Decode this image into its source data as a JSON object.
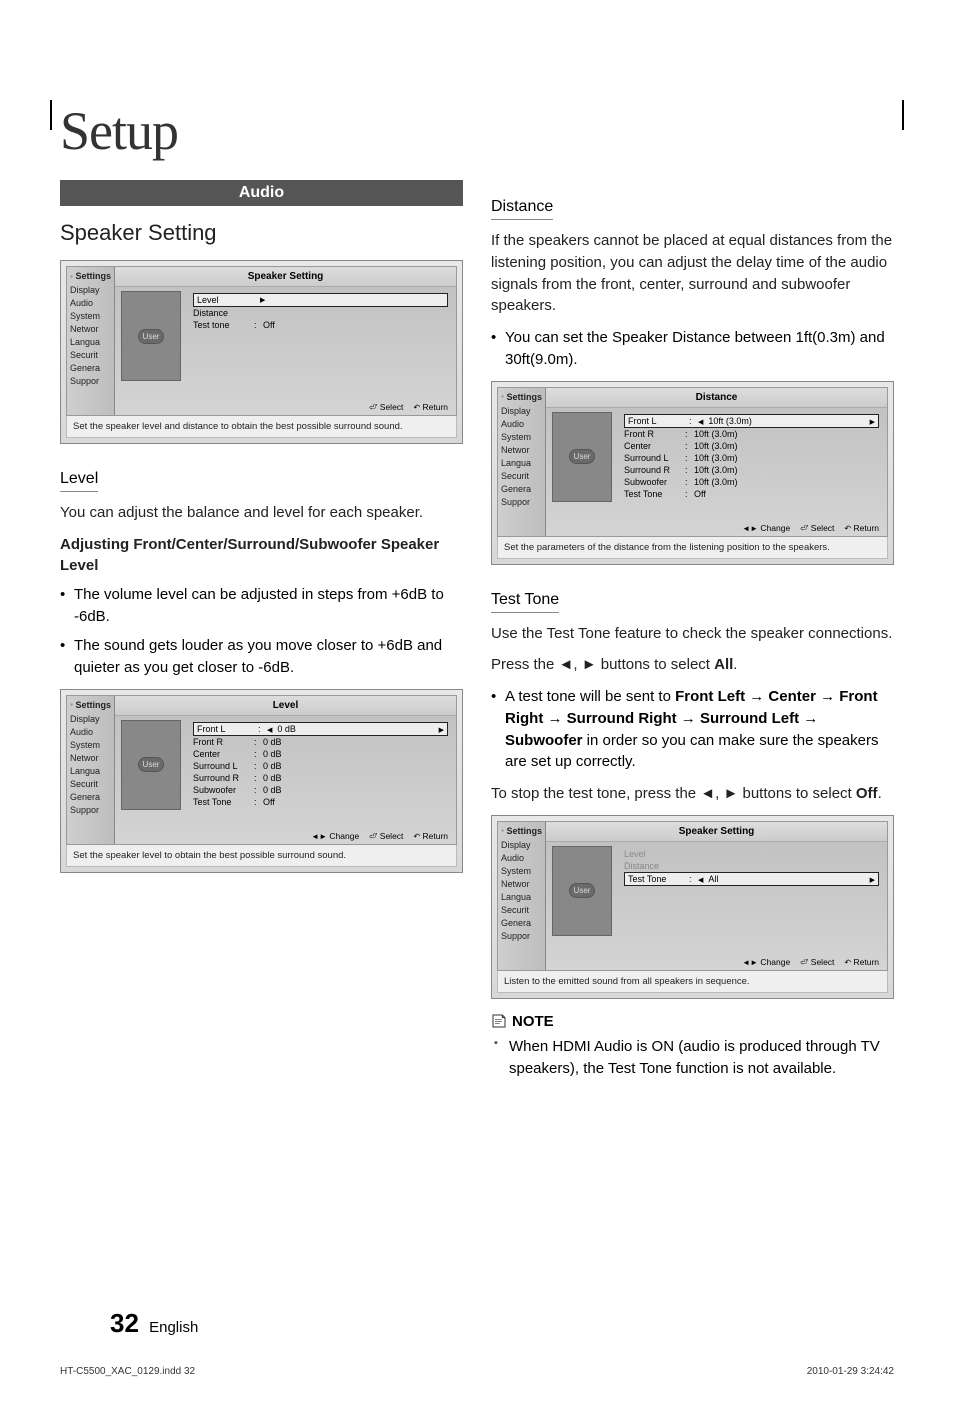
{
  "chapter": "Setup",
  "banner": "Audio",
  "speaker_setting": {
    "title": "Speaker Setting",
    "shot1": {
      "settings_label": "Settings",
      "menu": [
        "Display",
        "Audio",
        "System",
        "Networ",
        "Langua",
        "Securit",
        "Genera",
        "Suppor"
      ],
      "title": "Speaker Setting",
      "rows": [
        {
          "label": "Level",
          "val": ""
        },
        {
          "label": "Distance",
          "val": ""
        },
        {
          "label": "Test tone",
          "colon": ":",
          "val": "Off"
        }
      ],
      "footer_select": "Select",
      "footer_return": "Return",
      "user_badge": "User",
      "help": "Set the speaker level and distance to obtain the best possible surround sound."
    }
  },
  "level": {
    "title": "Level",
    "intro": "You can adjust the balance and level for each speaker.",
    "subhead": "Adjusting Front/Center/Surround/Subwoofer Speaker Level",
    "b1": "The volume level can be adjusted in steps from +6dB to -6dB.",
    "b2": "The sound gets louder as you move closer to +6dB and quieter as you get closer to -6dB.",
    "shot": {
      "title": "Level",
      "rows": [
        {
          "label": "Front L",
          "val": "0 dB",
          "sel": true
        },
        {
          "label": "Front R",
          "val": "0 dB"
        },
        {
          "label": "Center",
          "val": "0 dB"
        },
        {
          "label": "Surround L",
          "val": "0 dB"
        },
        {
          "label": "Surround R",
          "val": "0 dB"
        },
        {
          "label": "Subwoofer",
          "val": "0 dB"
        },
        {
          "label": "Test Tone",
          "val": "Off"
        }
      ],
      "footer_change": "Change",
      "footer_select": "Select",
      "footer_return": "Return",
      "help": "Set the speaker level to obtain the best possible surround sound."
    }
  },
  "distance": {
    "title": "Distance",
    "p1": "If the speakers cannot be placed at equal distances from the listening position, you can adjust the delay time of the audio signals from the front, center, surround and subwoofer speakers.",
    "b1": "You can set the Speaker Distance between 1ft(0.3m) and 30ft(9.0m).",
    "shot": {
      "title": "Distance",
      "rows": [
        {
          "label": "Front L",
          "val": "10ft (3.0m)",
          "sel": true
        },
        {
          "label": "Front R",
          "val": "10ft (3.0m)"
        },
        {
          "label": "Center",
          "val": "10ft (3.0m)"
        },
        {
          "label": "Surround L",
          "val": "10ft (3.0m)"
        },
        {
          "label": "Surround R",
          "val": "10ft (3.0m)"
        },
        {
          "label": "Subwoofer",
          "val": "10ft (3.0m)"
        },
        {
          "label": "Test Tone",
          "val": "Off"
        }
      ],
      "footer_change": "Change",
      "footer_select": "Select",
      "footer_return": "Return",
      "help": "Set the parameters of the distance from the listening position to the speakers."
    }
  },
  "testtone": {
    "title": "Test Tone",
    "p1": "Use the Test Tone feature to check the speaker connections.",
    "p2a": "Press the ◄, ► buttons to select ",
    "p2b": "All",
    "p2c": ".",
    "b1a": "A test tone will be sent to ",
    "b1b": "Front Left → Center → Front Right → Surround Right → Surround Left → Subwoofer",
    "b1c": " in order so you can make sure the speakers are set up correctly.",
    "p3a": "To stop the test tone, press the ◄, ► buttons to select ",
    "p3b": "Off",
    "p3c": ".",
    "shot": {
      "title": "Speaker Setting",
      "rows": [
        {
          "label": "Level",
          "dim": true
        },
        {
          "label": "Distance",
          "dim": true
        },
        {
          "label": "Test Tone",
          "val": "All",
          "sel": true
        }
      ],
      "footer_change": "Change",
      "footer_select": "Select",
      "footer_return": "Return",
      "help": "Listen to the emitted sound from all speakers in sequence."
    }
  },
  "note": {
    "label": "NOTE",
    "item": "When HDMI Audio is ON (audio is produced through TV speakers), the Test Tone function is not available."
  },
  "footer": {
    "page": "32",
    "lang": "English",
    "file": "HT-C5500_XAC_0129.indd   32",
    "ts": "2010-01-29   3:24:42"
  },
  "common": {
    "settings_label": "Settings",
    "menu": [
      "Display",
      "Audio",
      "System",
      "Networ",
      "Langua",
      "Securit",
      "Genera",
      "Suppor"
    ],
    "user_badge": "User",
    "change_key": "◄►",
    "select_key": "⏎",
    "return_key": "↶"
  }
}
